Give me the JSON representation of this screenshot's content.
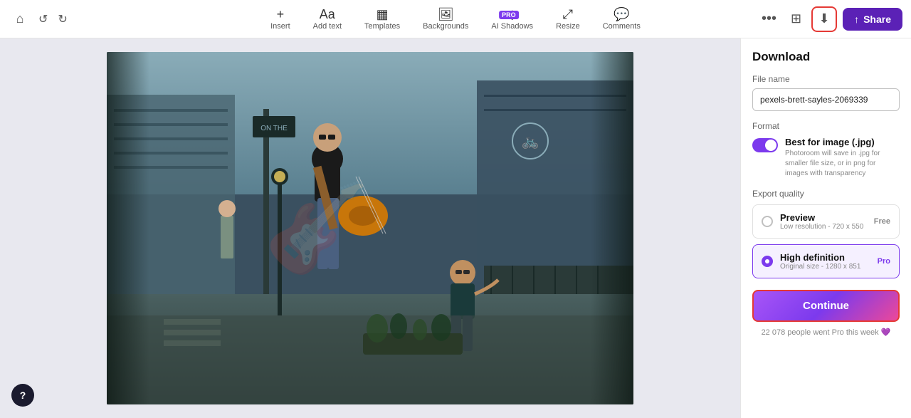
{
  "toolbar": {
    "home_icon": "⌂",
    "undo_icon": "↺",
    "redo_icon": "↻",
    "insert_label": "Insert",
    "insert_icon": "+",
    "addtext_label": "Add text",
    "addtext_icon": "Aa",
    "templates_label": "Templates",
    "templates_icon": "▦",
    "backgrounds_label": "Backgrounds",
    "backgrounds_icon": "🖼",
    "aishadows_label": "AI Shadows",
    "aishadows_icon": "◈",
    "pro_badge": "PRO",
    "resize_label": "Resize",
    "resize_icon": "⤢",
    "comments_label": "Comments",
    "comments_icon": "💬",
    "more_icon": "•••",
    "panels_icon": "⊞",
    "download_icon": "⬇",
    "share_icon": "↑",
    "share_label": "Share"
  },
  "download_panel": {
    "title": "Download",
    "file_name_label": "File name",
    "file_name_value": "pexels-brett-sayles-2069339",
    "format_label": "Format",
    "format_name": "Best for image (.jpg)",
    "format_desc": "Photoroom will save in .jpg for smaller file size, or in png for images with transparency",
    "quality_label": "Export quality",
    "preview_name": "Preview",
    "preview_size": "Low resolution - 720 x 550",
    "preview_tier": "Free",
    "hd_name": "High definition",
    "hd_size": "Original size - 1280 x 851",
    "hd_tier": "Pro",
    "continue_label": "Continue",
    "social_proof": "22 078 people went Pro this week 💜"
  },
  "help": {
    "icon": "?"
  }
}
